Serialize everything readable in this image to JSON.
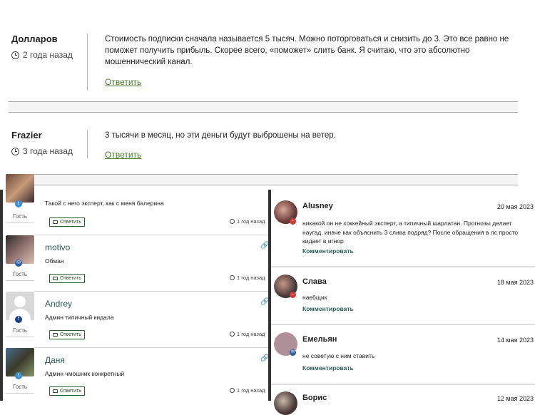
{
  "top_comments": [
    {
      "author": "Долларов",
      "time": "2 года назад",
      "text": "Стоимость подписки сначала называется 5 тысяч. Можно поторговаться и снизить до 3. Это все равно не поможет получить прибыль. Скорее всего, «поможет» слить банк. Я считаю, что это абсолютно мошеннический канал.",
      "reply": "Ответить"
    },
    {
      "author": "Frazier",
      "time": "3 года назад",
      "text": "3 тысячи в месяц, но эти деньги будут выброшены на ветер.",
      "reply": "Ответить"
    }
  ],
  "left_comments": [
    {
      "guest": "Гость",
      "text": "Такой с него эксперт, как с меня балерина",
      "reply": "Ответить",
      "time": "1 год назад",
      "badge": "tw"
    },
    {
      "name": "motivo",
      "guest": "Гость",
      "text": "Обман",
      "reply": "Ответить",
      "time": "1 год назад",
      "badge": "em"
    },
    {
      "name": "Andrey",
      "guest": "Гость",
      "text": "Админ типичный кидала",
      "reply": "Ответить",
      "time": "1 год назад",
      "badge": "fb"
    },
    {
      "name": "Даня",
      "guest": "Гость",
      "text": "Админ чмошник конкретный",
      "reply": "Ответить",
      "time": "1 год назад",
      "badge": "tw"
    }
  ],
  "right_comments": [
    {
      "name": "Alusney",
      "date": "20 мая 2023",
      "text": "никакой он не хоккейный эксперт, а типичный шарлатан. Прогнозы делает наугад, иначе как объяснить 3 слива подряд? После обращения в лс просто кидает в игнор",
      "action": "Комментировать"
    },
    {
      "name": "Слава",
      "date": "18 мая 2023",
      "text": "наебщик",
      "action": "Комментировать"
    },
    {
      "name": "Емельян",
      "date": "14 мая 2023",
      "text": "не советую с ним ставить",
      "action": "Комментировать"
    },
    {
      "name": "Борис",
      "date": "12 мая 2023"
    }
  ]
}
